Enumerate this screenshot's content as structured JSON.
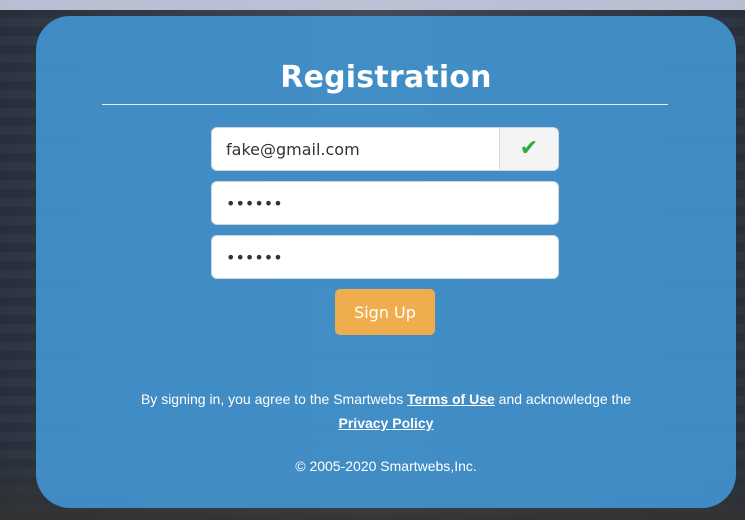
{
  "form": {
    "title": "Registration",
    "email": {
      "value": "fake@gmail.com",
      "status_icon": "check-icon",
      "status_color": "#2eaa3a"
    },
    "password": {
      "value": "••••••"
    },
    "confirm_password": {
      "value": "••••••"
    },
    "signup_label": "Sign Up",
    "signup_color": "#f0ad4e"
  },
  "legal": {
    "prefix": "By signing in, you agree to the Smartwebs ",
    "terms_label": "Terms of Use",
    "middle": " and acknowledge the",
    "privacy_label": "Privacy Policy"
  },
  "footer": {
    "copyright": "© 2005-2020 Smartwebs,Inc."
  },
  "theme": {
    "panel_color": "#4292cd"
  }
}
